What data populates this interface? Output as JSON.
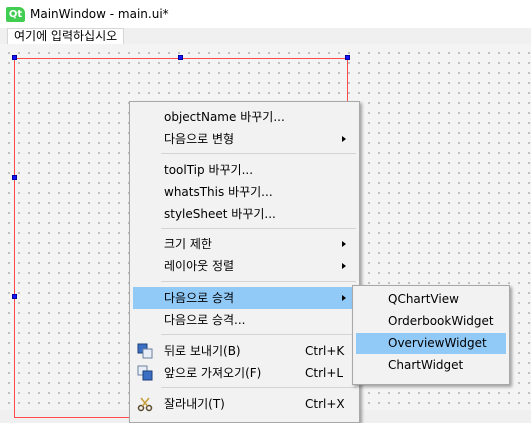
{
  "window": {
    "title": "MainWindow - main.ui*",
    "logo_text": "Qt"
  },
  "menubar": {
    "placeholder": "여기에 입력하십시오"
  },
  "context_menu": {
    "items": [
      {
        "label": "objectName 바꾸기...",
        "submenu": false
      },
      {
        "label": "다음으로 변형",
        "submenu": true
      },
      {
        "label": "toolTip 바꾸기...",
        "submenu": false
      },
      {
        "label": "whatsThis 바꾸기...",
        "submenu": false
      },
      {
        "label": "styleSheet 바꾸기...",
        "submenu": false
      },
      {
        "label": "크기 제한",
        "submenu": true
      },
      {
        "label": "레이아웃 정렬",
        "submenu": true
      },
      {
        "label": "다음으로 승격",
        "submenu": true,
        "highlighted": true
      },
      {
        "label": "다음으로 승격...",
        "submenu": false
      },
      {
        "label": "뒤로 보내기(B)",
        "shortcut": "Ctrl+K",
        "icon": "send-to-back-icon"
      },
      {
        "label": "앞으로 가져오기(F)",
        "shortcut": "Ctrl+L",
        "icon": "bring-to-front-icon"
      },
      {
        "label": "잘라내기(T)",
        "shortcut": "Ctrl+X",
        "icon": "scissors-icon"
      }
    ]
  },
  "promote_submenu": {
    "items": [
      {
        "label": "QChartView"
      },
      {
        "label": "OrderbookWidget"
      },
      {
        "label": "OverviewWidget",
        "highlighted": true
      },
      {
        "label": "ChartWidget"
      }
    ]
  },
  "colors": {
    "highlight": "#91c9f7",
    "form_border": "#ff4a4a",
    "handle": "#1515ff",
    "qt_green": "#41cd52"
  }
}
